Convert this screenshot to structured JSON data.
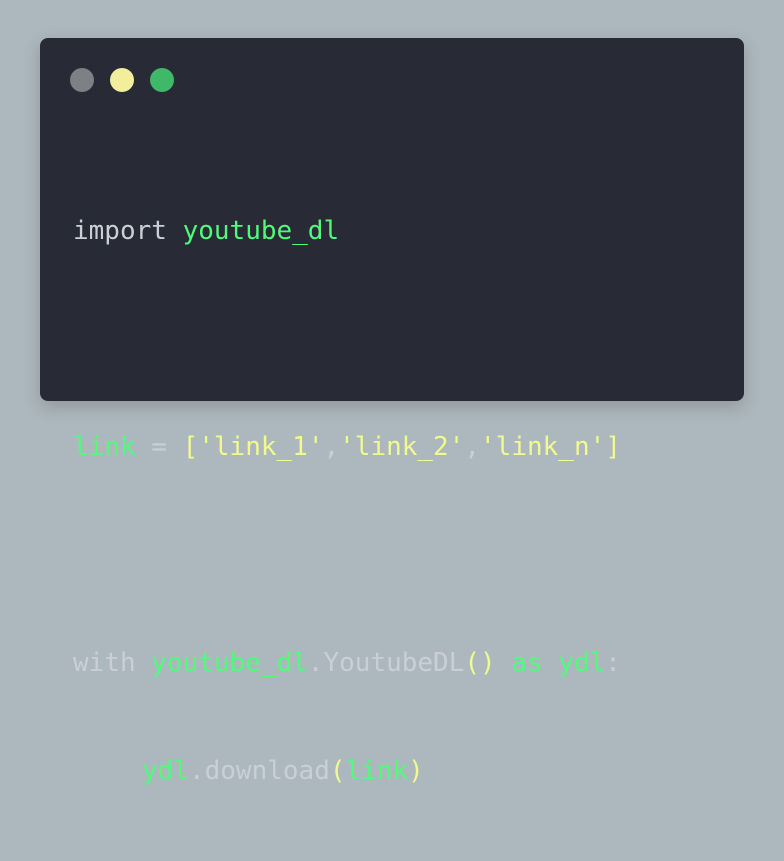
{
  "colors": {
    "page_background": "#adb8be",
    "window_background": "#282a36",
    "dot_close": "#7e8085",
    "dot_minimize": "#f3ee9c",
    "dot_maximize": "#3fb968",
    "text_plain": "#c9cfd6",
    "text_identifier": "#50fa7b",
    "text_keyword_green": "#50fa7b",
    "text_string": "#f1fa8c"
  },
  "window_controls": [
    "close-dot",
    "minimize-dot",
    "maximize-dot"
  ],
  "code": {
    "line1": {
      "kw_import": "import ",
      "mod": "youtube_dl"
    },
    "line2": {
      "var": "link",
      "op_assign": " = ",
      "br_open": "[",
      "s1": "'link_1'",
      "comma1": ",",
      "s2": "'link_2'",
      "comma2": ",",
      "s3": "'link_n'",
      "br_close": "]"
    },
    "line3": {
      "kw_with": "with ",
      "mod": "youtube_dl",
      "dot": ".",
      "cls": "YoutubeDL",
      "parens": "()",
      "kw_as": " as ",
      "alias": "ydl",
      "colon": ":"
    },
    "line4": {
      "obj": "ydl",
      "dot": ".",
      "method": "download",
      "p_open": "(",
      "arg": "link",
      "p_close": ")"
    }
  }
}
